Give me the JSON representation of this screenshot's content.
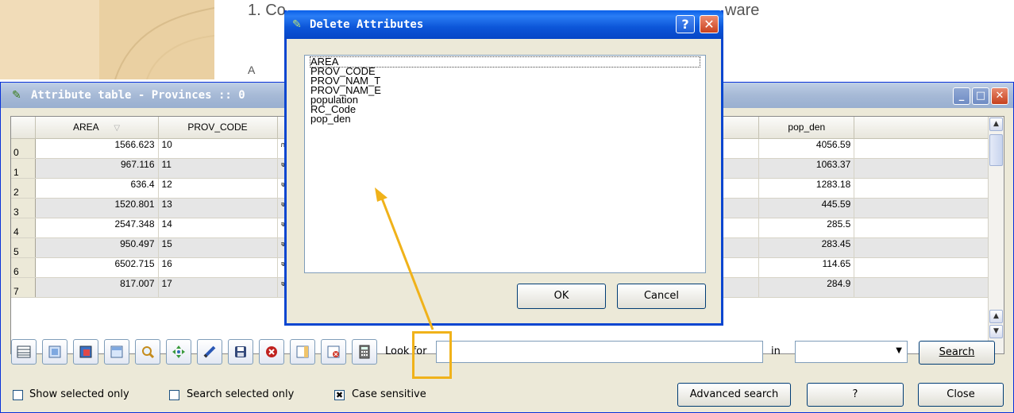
{
  "slide": {
    "title_fragment_left": "1. Co",
    "title_fragment_right": "ware",
    "subtitle_fragment": "A",
    "accent_color": "#f0b21a"
  },
  "attribute_window": {
    "title": "Attribute table - Provinces :: 0",
    "title_icon": "qgis-icon",
    "minimize": "_",
    "maximize": "□",
    "close": "✕",
    "columns": [
      "AREA",
      "PROV_CODE",
      "",
      "",
      "",
      "pop_den"
    ],
    "rows": [
      {
        "index": "0",
        "area": "1566.623",
        "prov_code": "10",
        "prov_nam_t": "ก",
        "pop_den": "4056.59"
      },
      {
        "index": "1",
        "area": "967.116",
        "prov_code": "11",
        "prov_nam_t": "จ.",
        "pop_den": "1063.37"
      },
      {
        "index": "2",
        "area": "636.4",
        "prov_code": "12",
        "prov_nam_t": "จ.",
        "pop_den": "1283.18"
      },
      {
        "index": "3",
        "area": "1520.801",
        "prov_code": "13",
        "prov_nam_t": "จ.",
        "pop_den": "445.59"
      },
      {
        "index": "4",
        "area": "2547.348",
        "prov_code": "14",
        "prov_nam_t": "จ.",
        "pop_den": "285.5"
      },
      {
        "index": "5",
        "area": "950.497",
        "prov_code": "15",
        "prov_nam_t": "จ.",
        "pop_den": "283.45"
      },
      {
        "index": "6",
        "area": "6502.715",
        "prov_code": "16",
        "prov_nam_t": "จ.",
        "pop_den": "114.65"
      },
      {
        "index": "7",
        "area": "817.007",
        "prov_code": "17",
        "prov_nam_t": "จ.",
        "pop_den": "284.9"
      }
    ],
    "toolbar": {
      "look_for_label": "Look for",
      "look_for_value": "",
      "in_label": "in",
      "in_value": "",
      "search_button": "Search",
      "show_selected_only": "Show selected only",
      "search_selected_only": "Search selected only",
      "case_sensitive": "Case sensitive",
      "case_sensitive_checked": true,
      "advanced_search_button": "Advanced search",
      "help_button": "?",
      "close_button": "Close",
      "tool_icons": [
        "table-icon",
        "zoom-to-selection-icon",
        "invert-selection-icon",
        "move-selection-to-top-icon",
        "find-icon",
        "pan-icon",
        "edit-pencil-icon",
        "save-icon",
        "remove-icon",
        "add-column-icon",
        "delete-column-icon",
        "calculator-icon"
      ]
    }
  },
  "delete_dialog": {
    "title": "Delete Attributes",
    "help": "?",
    "close": "✕",
    "items": [
      "AREA",
      "PROV_CODE",
      "PROV_NAM_T",
      "PROV_NAM_E",
      "population",
      "RC_Code",
      "pop_den"
    ],
    "ok_button": "OK",
    "cancel_button": "Cancel"
  }
}
